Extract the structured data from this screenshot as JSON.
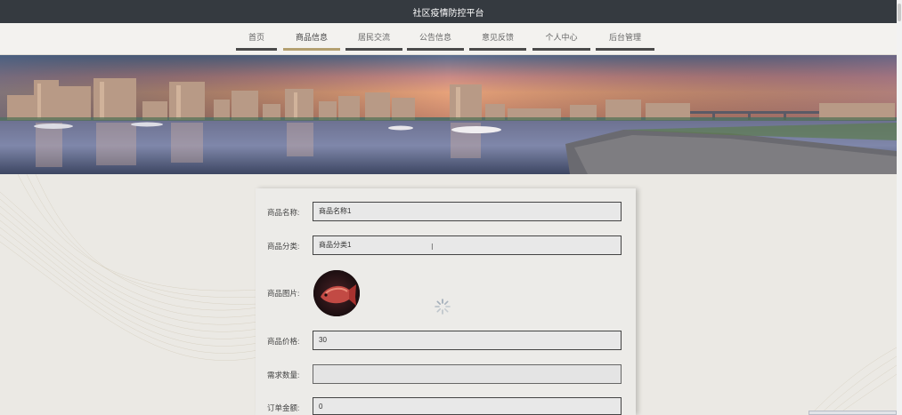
{
  "header": {
    "title": "社区疫情防控平台"
  },
  "nav": {
    "items": [
      {
        "label": "首页",
        "active": false
      },
      {
        "label": "商品信息",
        "active": true
      },
      {
        "label": "居民交流",
        "active": false
      },
      {
        "label": "公告信息",
        "active": false
      },
      {
        "label": "意见反馈",
        "active": false
      },
      {
        "label": "个人中心",
        "active": false
      },
      {
        "label": "后台管理",
        "active": false
      }
    ]
  },
  "form": {
    "name_label": "商品名称:",
    "name_value": "商品名称1",
    "category_label": "商品分类:",
    "category_value": "商品分类1",
    "image_label": "商品图片:",
    "price_label": "商品价格:",
    "price_value": "30",
    "quantity_label": "需求数量:",
    "quantity_value": "",
    "total_label": "订单金额:",
    "total_value": "0"
  },
  "colors": {
    "topbar": "#353a40",
    "nav_active_underline": "#b3a070",
    "nav_underline": "#4a4a4a",
    "page_background": "#ebe9e4"
  },
  "icons": {
    "loading": "loading-spinner-icon",
    "text_cursor": "text-cursor-icon"
  }
}
